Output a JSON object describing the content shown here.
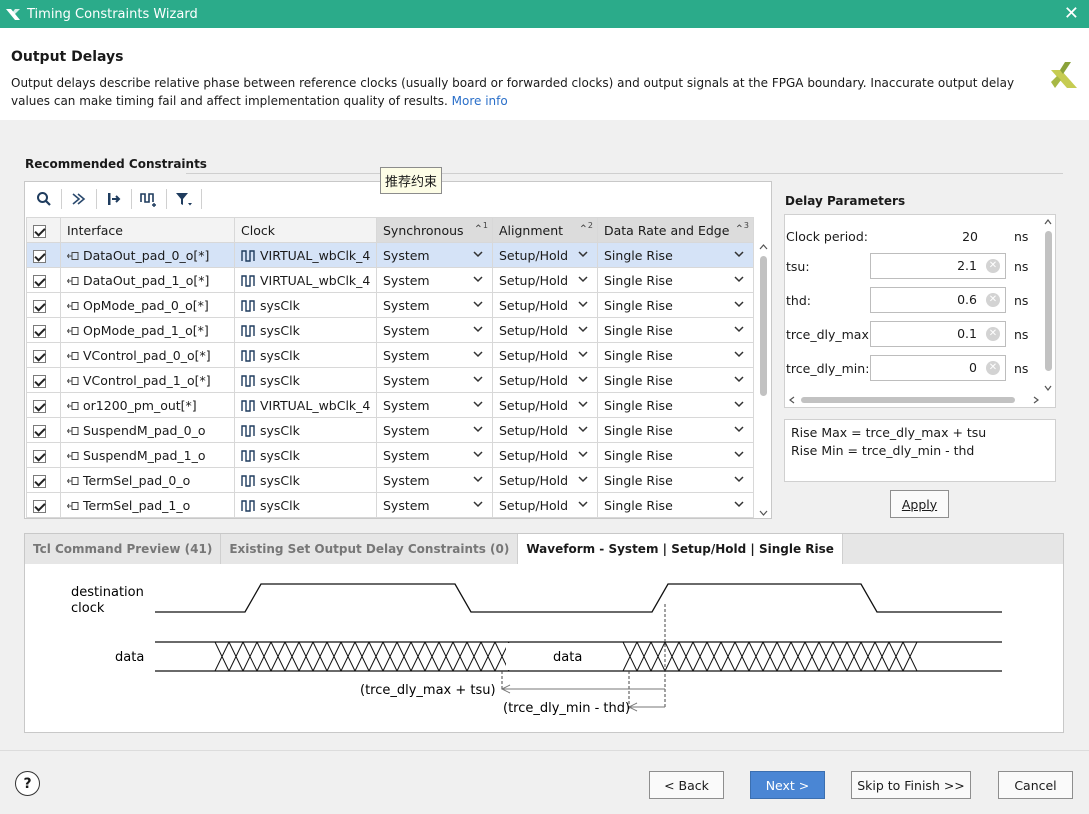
{
  "window": {
    "title": "Timing Constraints Wizard",
    "close_glyph": "✕"
  },
  "header": {
    "title": "Output Delays",
    "description": "Output delays describe relative phase between reference clocks (usually board or forwarded clocks) and output signals at the FPGA boundary. Inaccurate output delay values can make timing fail and affect implementation quality of results.",
    "more_info": "More info"
  },
  "section_label": "Recommended Constraints",
  "tooltip": "推荐约束",
  "toolbar": {
    "icons": [
      "search-icon",
      "collapse-icon",
      "expand-icon",
      "clock-add-icon",
      "filter-icon"
    ]
  },
  "table": {
    "columns": [
      {
        "label": "Interface",
        "sort": ""
      },
      {
        "label": "Clock",
        "sort": ""
      },
      {
        "label": "Synchronous",
        "sort": "1"
      },
      {
        "label": "Alignment",
        "sort": "2"
      },
      {
        "label": "Data Rate and Edge",
        "sort": "3"
      }
    ],
    "rows": [
      {
        "interface": "DataOut_pad_0_o[*]",
        "clock": "VIRTUAL_wbClk_4",
        "sync": "System",
        "align": "Setup/Hold",
        "rate": "Single Rise"
      },
      {
        "interface": "DataOut_pad_1_o[*]",
        "clock": "VIRTUAL_wbClk_4",
        "sync": "System",
        "align": "Setup/Hold",
        "rate": "Single Rise"
      },
      {
        "interface": "OpMode_pad_0_o[*]",
        "clock": "sysClk",
        "sync": "System",
        "align": "Setup/Hold",
        "rate": "Single Rise"
      },
      {
        "interface": "OpMode_pad_1_o[*]",
        "clock": "sysClk",
        "sync": "System",
        "align": "Setup/Hold",
        "rate": "Single Rise"
      },
      {
        "interface": "VControl_pad_0_o[*]",
        "clock": "sysClk",
        "sync": "System",
        "align": "Setup/Hold",
        "rate": "Single Rise"
      },
      {
        "interface": "VControl_pad_1_o[*]",
        "clock": "sysClk",
        "sync": "System",
        "align": "Setup/Hold",
        "rate": "Single Rise"
      },
      {
        "interface": "or1200_pm_out[*]",
        "clock": "VIRTUAL_wbClk_4",
        "sync": "System",
        "align": "Setup/Hold",
        "rate": "Single Rise"
      },
      {
        "interface": "SuspendM_pad_0_o",
        "clock": "sysClk",
        "sync": "System",
        "align": "Setup/Hold",
        "rate": "Single Rise"
      },
      {
        "interface": "SuspendM_pad_1_o",
        "clock": "sysClk",
        "sync": "System",
        "align": "Setup/Hold",
        "rate": "Single Rise"
      },
      {
        "interface": "TermSel_pad_0_o",
        "clock": "sysClk",
        "sync": "System",
        "align": "Setup/Hold",
        "rate": "Single Rise"
      },
      {
        "interface": "TermSel_pad_1_o",
        "clock": "sysClk",
        "sync": "System",
        "align": "Setup/Hold",
        "rate": "Single Rise"
      }
    ]
  },
  "delay_params": {
    "title": "Delay Parameters",
    "clock_period_label": "Clock period:",
    "clock_period_value": "20",
    "unit": "ns",
    "fields": [
      {
        "label": "tsu:",
        "value": "2.1"
      },
      {
        "label": "thd:",
        "value": "0.6"
      },
      {
        "label": "trce_dly_max:",
        "value": "0.1"
      },
      {
        "label": "trce_dly_min:",
        "value": "0"
      }
    ],
    "formula_max": "Rise Max = trce_dly_max + tsu",
    "formula_min": "Rise Min = trce_dly_min - thd",
    "apply": "Apply"
  },
  "tabs": [
    {
      "label": "Tcl Command Preview (41)"
    },
    {
      "label": "Existing Set Output Delay Constraints (0)"
    },
    {
      "label": "Waveform - System | Setup/Hold | Single Rise"
    }
  ],
  "waveform": {
    "clock_label_1": "destination",
    "clock_label_2": "clock",
    "data_label": "data",
    "data_center_label": "data",
    "max_label": "(trce_dly_max + tsu)",
    "min_label": "(trce_dly_min - thd)"
  },
  "footer": {
    "help": "?",
    "back": "< Back",
    "next": "Next >",
    "skip": "Skip to Finish >>",
    "cancel": "Cancel"
  },
  "colors": {
    "titlebar": "#2bab8a",
    "accent": "#4a86d4",
    "selected_row": "#d5e3f7",
    "link": "#2a6fc9"
  }
}
